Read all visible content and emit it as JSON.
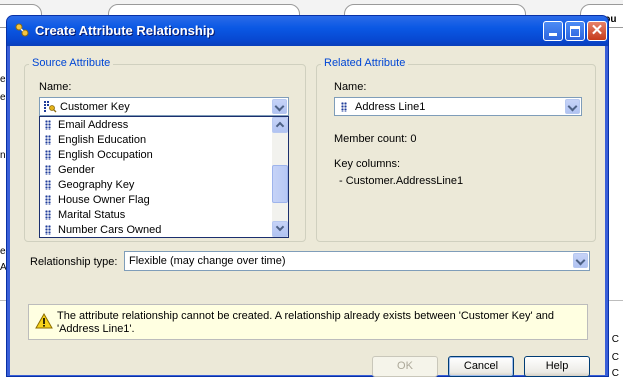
{
  "background": {
    "right_tab_label": "Cou",
    "left_fragments": [
      "e",
      "e",
      "n",
      "ed",
      "At I"
    ],
    "right_fragments": [
      "C",
      "C",
      "C"
    ]
  },
  "dialog": {
    "title": "Create Attribute Relationship",
    "source": {
      "group_title": "Source Attribute",
      "name_label": "Name:",
      "selected": "Customer Key",
      "list_items": [
        "Email Address",
        "English Education",
        "English Occupation",
        "Gender",
        "Geography Key",
        "House Owner Flag",
        "Marital Status",
        "Number Cars Owned"
      ]
    },
    "related": {
      "group_title": "Related Attribute",
      "name_label": "Name:",
      "selected": "Address Line1",
      "member_count": "Member count: 0",
      "key_columns_label": "Key columns:",
      "key_column_value": "- Customer.AddressLine1"
    },
    "relationship": {
      "label": "Relationship type:",
      "value": "Flexible (may change over time)"
    },
    "warning": "The attribute relationship cannot be created. A relationship already exists between 'Customer Key' and 'Address Line1'.",
    "buttons": {
      "ok": "OK",
      "cancel": "Cancel",
      "help": "Help"
    }
  }
}
